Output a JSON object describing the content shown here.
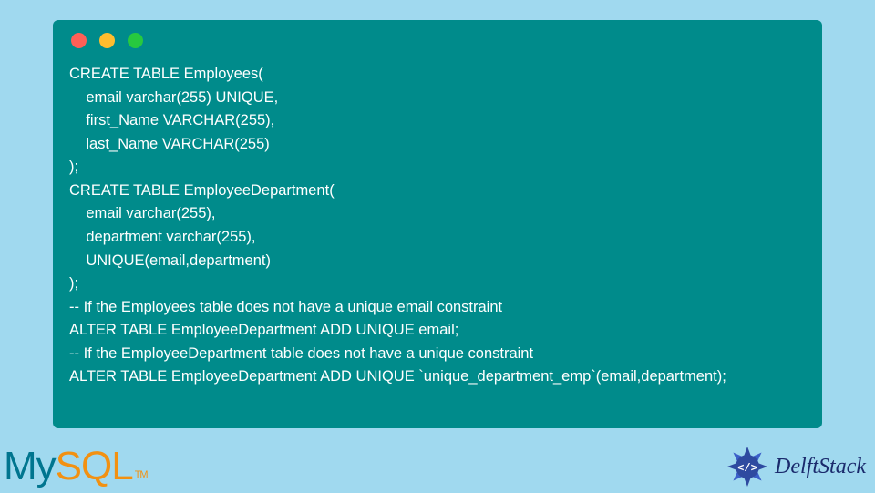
{
  "code": {
    "lines": [
      "CREATE TABLE Employees(",
      "    email varchar(255) UNIQUE,",
      "    first_Name VARCHAR(255),",
      "    last_Name VARCHAR(255)",
      ");",
      "CREATE TABLE EmployeeDepartment(",
      "    email varchar(255),",
      "    department varchar(255),",
      "    UNIQUE(email,department)",
      ");",
      "-- If the Employees table does not have a unique email constraint",
      "ALTER TABLE EmployeeDepartment ADD UNIQUE email;",
      "-- If the EmployeeDepartment table does not have a unique constraint",
      "ALTER TABLE EmployeeDepartment ADD UNIQUE `unique_department_emp`(email,department);"
    ]
  },
  "logos": {
    "mysql": {
      "my": "My",
      "sql": "SQL",
      "tm": "TM"
    },
    "delft": {
      "text": "DelftStack"
    }
  },
  "colors": {
    "page_bg": "#a0d9ef",
    "code_bg": "#008b8b",
    "code_text": "#ffffff",
    "mysql_blue": "#00758f",
    "mysql_orange": "#f29111",
    "delft_blue": "#1a2a6c"
  }
}
